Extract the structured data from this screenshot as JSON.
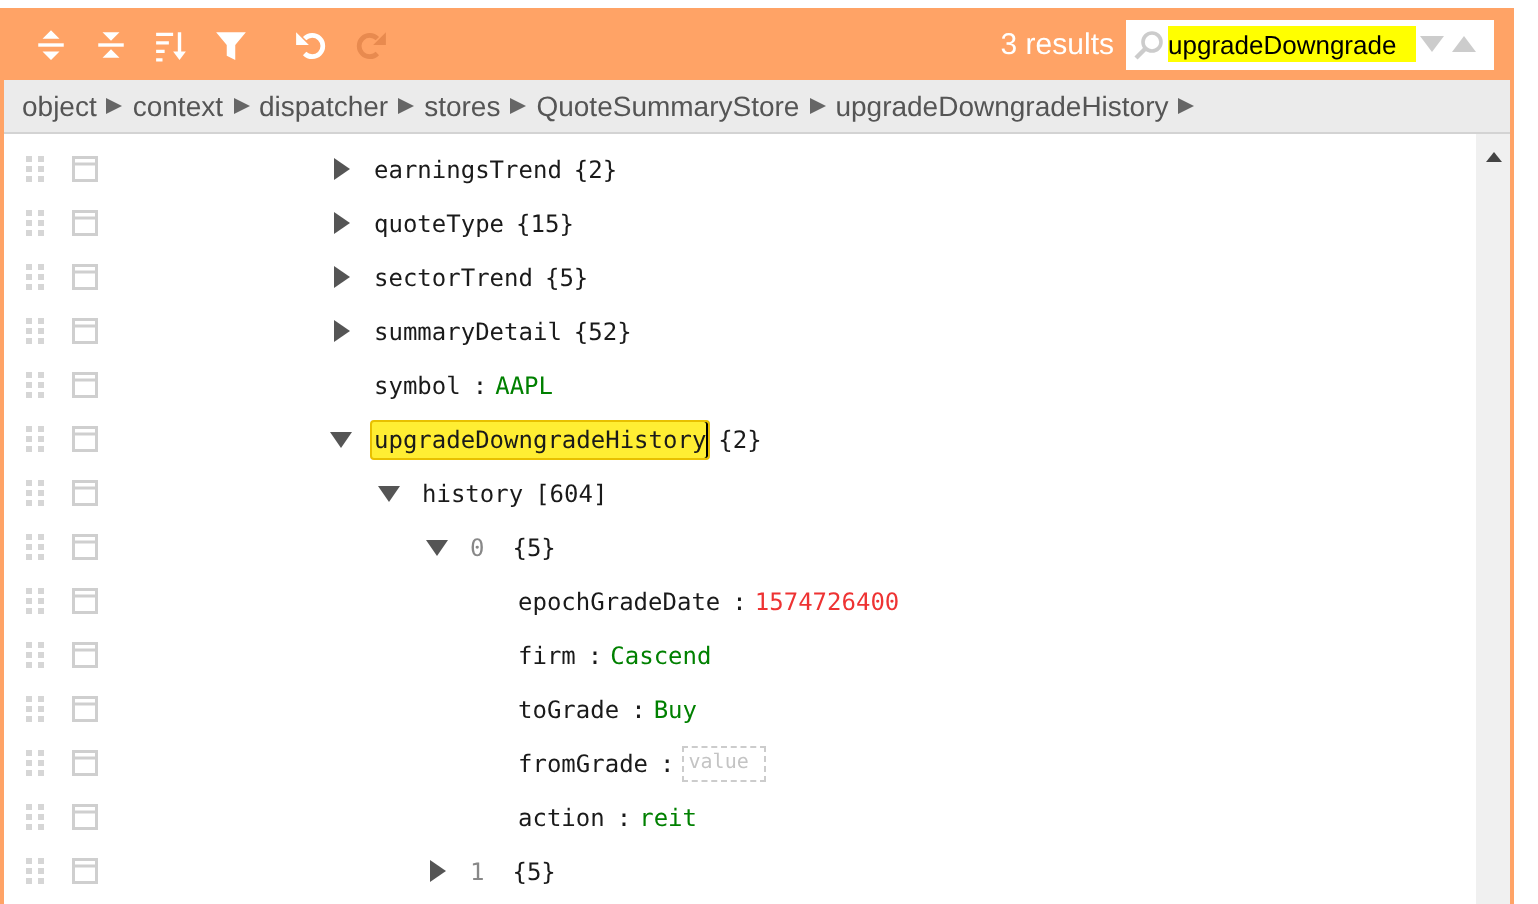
{
  "toolbar": {
    "buttons": [
      {
        "kind": "expand-all",
        "disabled": false
      },
      {
        "kind": "collapse-all",
        "disabled": false
      },
      {
        "kind": "sort",
        "disabled": false
      },
      {
        "kind": "filter",
        "disabled": false
      },
      {
        "kind": "undo",
        "disabled": false
      },
      {
        "kind": "redo",
        "disabled": true
      }
    ],
    "search": {
      "results": "3 results",
      "value": "upgradeDowngrade"
    }
  },
  "breadcrumb": [
    "object",
    "context",
    "dispatcher",
    "stores",
    "QuoteSummaryStore",
    "upgradeDowngradeHistory"
  ],
  "tree": [
    {
      "kind": "object",
      "key": "earningsTrend",
      "count": "{2}",
      "expanded": false,
      "highlighted": false
    },
    {
      "kind": "object",
      "key": "quoteType",
      "count": "{15}",
      "expanded": false,
      "highlighted": false
    },
    {
      "kind": "object",
      "key": "sectorTrend",
      "count": "{5}",
      "expanded": false,
      "highlighted": false
    },
    {
      "kind": "object",
      "key": "summaryDetail",
      "count": "{52}",
      "expanded": false,
      "highlighted": false
    },
    {
      "kind": "string",
      "key": "symbol",
      "separator": ":",
      "value": "AAPL",
      "highlighted": false
    },
    {
      "kind": "object",
      "key": "upgradeDowngradeHistory",
      "count": "{2}",
      "expanded": true,
      "highlighted": true,
      "children": [
        {
          "kind": "object",
          "key": "history",
          "count": "[604]",
          "expanded": true,
          "highlighted": false,
          "children": [
            {
              "kind": "index",
              "key": "0",
              "count": "{5}",
              "expanded": true,
              "highlighted": false,
              "children": [
                {
                  "kind": "number",
                  "key": "epochGradeDate",
                  "separator": ":",
                  "value": "1574726400",
                  "highlighted": false
                },
                {
                  "kind": "string",
                  "key": "firm",
                  "separator": ":",
                  "value": "Cascend",
                  "highlighted": false
                },
                {
                  "kind": "string",
                  "key": "toGrade",
                  "separator": ":",
                  "value": "Buy",
                  "highlighted": false
                },
                {
                  "kind": "empty",
                  "key": "fromGrade",
                  "separator": ":",
                  "placeholder": "value",
                  "highlighted": false
                },
                {
                  "kind": "string",
                  "key": "action",
                  "separator": ":",
                  "value": "reit",
                  "highlighted": false
                }
              ]
            },
            {
              "kind": "index",
              "key": "1",
              "count": "{5}",
              "expanded": false,
              "highlighted": false
            }
          ]
        }
      ]
    }
  ]
}
